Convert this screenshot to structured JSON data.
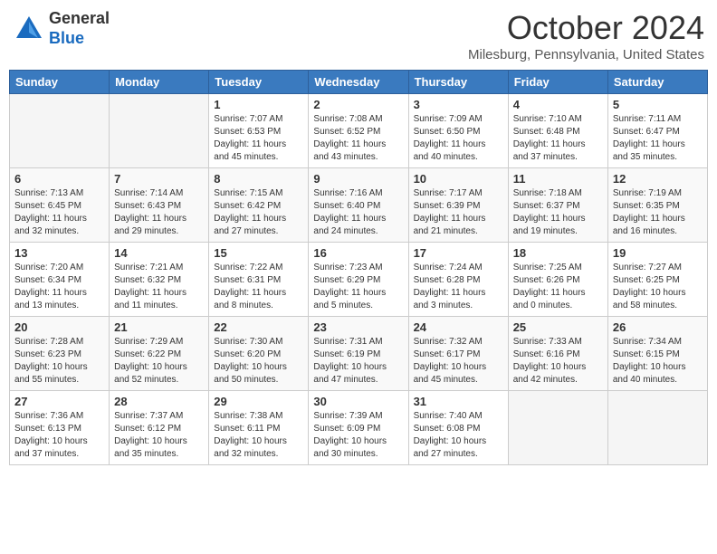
{
  "header": {
    "logo_general": "General",
    "logo_blue": "Blue",
    "month_title": "October 2024",
    "location": "Milesburg, Pennsylvania, United States"
  },
  "days_of_week": [
    "Sunday",
    "Monday",
    "Tuesday",
    "Wednesday",
    "Thursday",
    "Friday",
    "Saturday"
  ],
  "weeks": [
    [
      {
        "num": "",
        "info": ""
      },
      {
        "num": "",
        "info": ""
      },
      {
        "num": "1",
        "info": "Sunrise: 7:07 AM\nSunset: 6:53 PM\nDaylight: 11 hours and 45 minutes."
      },
      {
        "num": "2",
        "info": "Sunrise: 7:08 AM\nSunset: 6:52 PM\nDaylight: 11 hours and 43 minutes."
      },
      {
        "num": "3",
        "info": "Sunrise: 7:09 AM\nSunset: 6:50 PM\nDaylight: 11 hours and 40 minutes."
      },
      {
        "num": "4",
        "info": "Sunrise: 7:10 AM\nSunset: 6:48 PM\nDaylight: 11 hours and 37 minutes."
      },
      {
        "num": "5",
        "info": "Sunrise: 7:11 AM\nSunset: 6:47 PM\nDaylight: 11 hours and 35 minutes."
      }
    ],
    [
      {
        "num": "6",
        "info": "Sunrise: 7:13 AM\nSunset: 6:45 PM\nDaylight: 11 hours and 32 minutes."
      },
      {
        "num": "7",
        "info": "Sunrise: 7:14 AM\nSunset: 6:43 PM\nDaylight: 11 hours and 29 minutes."
      },
      {
        "num": "8",
        "info": "Sunrise: 7:15 AM\nSunset: 6:42 PM\nDaylight: 11 hours and 27 minutes."
      },
      {
        "num": "9",
        "info": "Sunrise: 7:16 AM\nSunset: 6:40 PM\nDaylight: 11 hours and 24 minutes."
      },
      {
        "num": "10",
        "info": "Sunrise: 7:17 AM\nSunset: 6:39 PM\nDaylight: 11 hours and 21 minutes."
      },
      {
        "num": "11",
        "info": "Sunrise: 7:18 AM\nSunset: 6:37 PM\nDaylight: 11 hours and 19 minutes."
      },
      {
        "num": "12",
        "info": "Sunrise: 7:19 AM\nSunset: 6:35 PM\nDaylight: 11 hours and 16 minutes."
      }
    ],
    [
      {
        "num": "13",
        "info": "Sunrise: 7:20 AM\nSunset: 6:34 PM\nDaylight: 11 hours and 13 minutes."
      },
      {
        "num": "14",
        "info": "Sunrise: 7:21 AM\nSunset: 6:32 PM\nDaylight: 11 hours and 11 minutes."
      },
      {
        "num": "15",
        "info": "Sunrise: 7:22 AM\nSunset: 6:31 PM\nDaylight: 11 hours and 8 minutes."
      },
      {
        "num": "16",
        "info": "Sunrise: 7:23 AM\nSunset: 6:29 PM\nDaylight: 11 hours and 5 minutes."
      },
      {
        "num": "17",
        "info": "Sunrise: 7:24 AM\nSunset: 6:28 PM\nDaylight: 11 hours and 3 minutes."
      },
      {
        "num": "18",
        "info": "Sunrise: 7:25 AM\nSunset: 6:26 PM\nDaylight: 11 hours and 0 minutes."
      },
      {
        "num": "19",
        "info": "Sunrise: 7:27 AM\nSunset: 6:25 PM\nDaylight: 10 hours and 58 minutes."
      }
    ],
    [
      {
        "num": "20",
        "info": "Sunrise: 7:28 AM\nSunset: 6:23 PM\nDaylight: 10 hours and 55 minutes."
      },
      {
        "num": "21",
        "info": "Sunrise: 7:29 AM\nSunset: 6:22 PM\nDaylight: 10 hours and 52 minutes."
      },
      {
        "num": "22",
        "info": "Sunrise: 7:30 AM\nSunset: 6:20 PM\nDaylight: 10 hours and 50 minutes."
      },
      {
        "num": "23",
        "info": "Sunrise: 7:31 AM\nSunset: 6:19 PM\nDaylight: 10 hours and 47 minutes."
      },
      {
        "num": "24",
        "info": "Sunrise: 7:32 AM\nSunset: 6:17 PM\nDaylight: 10 hours and 45 minutes."
      },
      {
        "num": "25",
        "info": "Sunrise: 7:33 AM\nSunset: 6:16 PM\nDaylight: 10 hours and 42 minutes."
      },
      {
        "num": "26",
        "info": "Sunrise: 7:34 AM\nSunset: 6:15 PM\nDaylight: 10 hours and 40 minutes."
      }
    ],
    [
      {
        "num": "27",
        "info": "Sunrise: 7:36 AM\nSunset: 6:13 PM\nDaylight: 10 hours and 37 minutes."
      },
      {
        "num": "28",
        "info": "Sunrise: 7:37 AM\nSunset: 6:12 PM\nDaylight: 10 hours and 35 minutes."
      },
      {
        "num": "29",
        "info": "Sunrise: 7:38 AM\nSunset: 6:11 PM\nDaylight: 10 hours and 32 minutes."
      },
      {
        "num": "30",
        "info": "Sunrise: 7:39 AM\nSunset: 6:09 PM\nDaylight: 10 hours and 30 minutes."
      },
      {
        "num": "31",
        "info": "Sunrise: 7:40 AM\nSunset: 6:08 PM\nDaylight: 10 hours and 27 minutes."
      },
      {
        "num": "",
        "info": ""
      },
      {
        "num": "",
        "info": ""
      }
    ]
  ]
}
